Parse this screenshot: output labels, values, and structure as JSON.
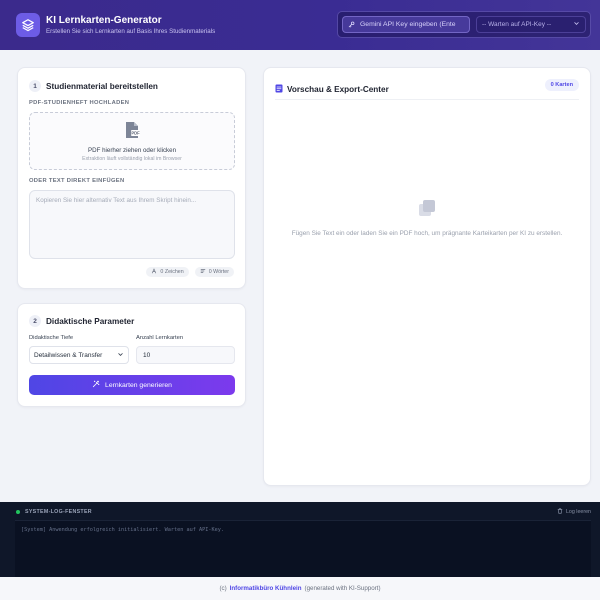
{
  "header": {
    "title": "KI Lernkarten-Generator",
    "subtitle": "Erstellen Sie sich Lernkarten auf Basis Ihres Studienmaterials",
    "api_key_placeholder": "Gemini API Key eingeben (Ente",
    "model_select_value": "-- Warten auf API-Key --",
    "logo_icon": "layers-icon",
    "key_icon": "key-icon"
  },
  "source_card": {
    "step": "1",
    "title": "Studienmaterial bereitstellen",
    "pdf_label": "PDF-Studienheft hochladen",
    "drop_title": "PDF hierher ziehen oder klicken",
    "drop_subtitle": "Extraktion läuft vollständig lokal im Browser",
    "text_label": "Oder Text direkt einfügen",
    "text_placeholder": "Kopieren Sie hier alternativ Text aus Ihrem Skript hinein...",
    "char_count": "0 Zeichen",
    "word_count": "0 Wörter"
  },
  "params_card": {
    "step": "2",
    "title": "Didaktische Parameter",
    "depth_label": "Didaktische Tiefe",
    "depth_value": "Detailwissen & Transfer",
    "count_label": "Anzahl Lernkarten",
    "count_value": "10",
    "generate_label": "Lernkarten generieren"
  },
  "preview": {
    "title": "Vorschau & Export-Center",
    "badge": "0 Karten",
    "empty_text": "Fügen Sie Text ein oder laden Sie ein PDF hoch, um prägnante Karteikarten per KI zu erstellen."
  },
  "log": {
    "title": "SYSTEM-LOG-FENSTER",
    "clear_label": "Log leeren",
    "entry": "[System] Anwendung erfolgreich initialisiert. Warten auf API-Key."
  },
  "footer": {
    "prefix": "(c)",
    "brand": "Informatikbüro Kühnlein",
    "suffix": "(generated with KI-Support)"
  },
  "colors": {
    "header_bg": "#3b2a8c",
    "accent": "#4f46e5",
    "accent_end": "#7c3aed",
    "log_bg": "#0f1729",
    "status_dot": "#22c55e"
  }
}
